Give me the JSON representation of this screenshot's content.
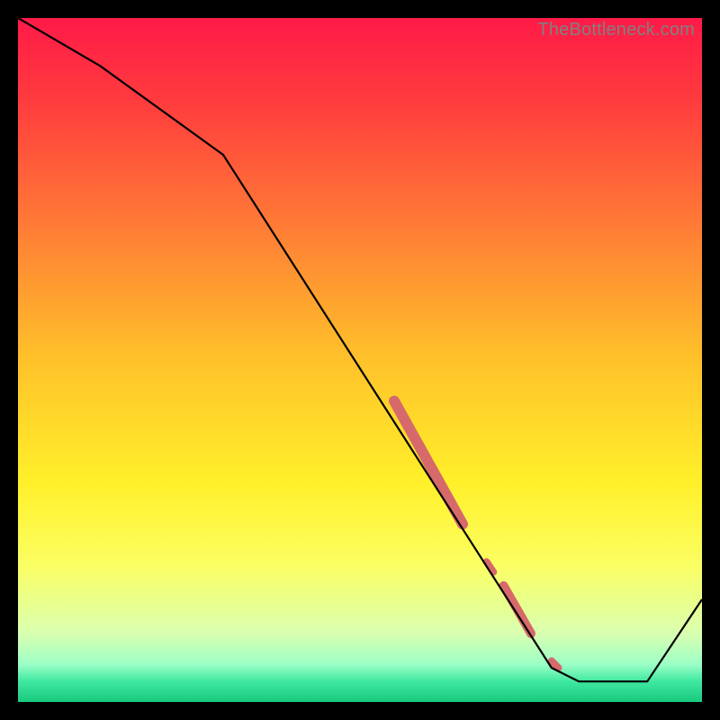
{
  "watermark": "TheBottleneck.com",
  "chart_data": {
    "type": "line",
    "title": "",
    "xlabel": "",
    "ylabel": "",
    "xlim": [
      0,
      100
    ],
    "ylim": [
      0,
      100
    ],
    "grid": false,
    "series": [
      {
        "name": "curve",
        "x": [
          0,
          12,
          30,
          78,
          82,
          92,
          100
        ],
        "y": [
          100,
          93,
          80,
          5,
          3,
          3,
          15
        ]
      }
    ],
    "highlight_segments": [
      {
        "x": [
          55,
          65
        ],
        "y": [
          44,
          26
        ],
        "width": 12
      },
      {
        "x": [
          68.5,
          69.5
        ],
        "y": [
          20.5,
          19
        ],
        "width": 8
      },
      {
        "x": [
          71,
          75
        ],
        "y": [
          17,
          10
        ],
        "width": 10
      },
      {
        "x": [
          78,
          79
        ],
        "y": [
          6,
          5
        ],
        "width": 8
      }
    ],
    "gradient_stops": [
      {
        "offset": 0.0,
        "color": "#ff1a48"
      },
      {
        "offset": 0.12,
        "color": "#ff3b3e"
      },
      {
        "offset": 0.3,
        "color": "#ff7a36"
      },
      {
        "offset": 0.5,
        "color": "#ffc22a"
      },
      {
        "offset": 0.68,
        "color": "#fff02a"
      },
      {
        "offset": 0.8,
        "color": "#fbff63"
      },
      {
        "offset": 0.9,
        "color": "#d9ffb0"
      },
      {
        "offset": 0.945,
        "color": "#9cffc6"
      },
      {
        "offset": 0.97,
        "color": "#3fe8a0"
      },
      {
        "offset": 1.0,
        "color": "#18c97e"
      }
    ],
    "highlight_color": "#d66a6a"
  }
}
